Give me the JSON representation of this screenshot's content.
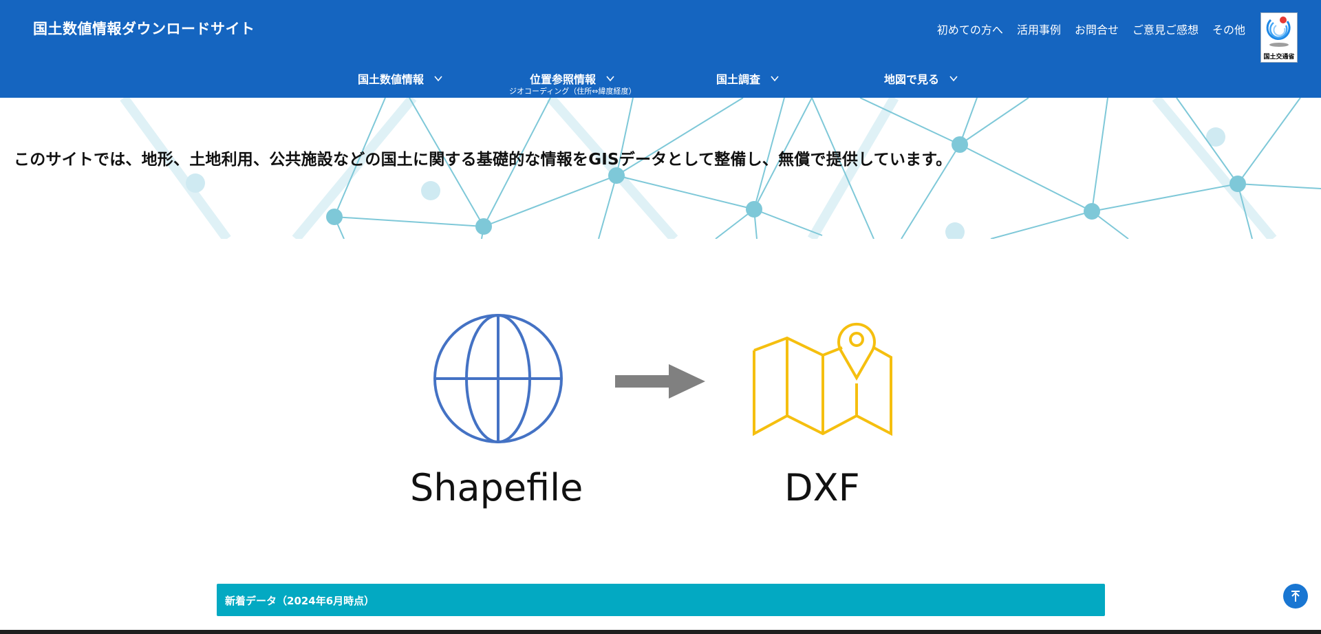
{
  "header": {
    "site_title": "国土数値情報ダウンロードサイト",
    "util_nav": [
      "初めての方へ",
      "活用事例",
      "お問合せ",
      "ご意見ご感想",
      "その他"
    ],
    "logo_text": "国土交通省"
  },
  "main_nav": {
    "items": [
      {
        "label": "国土数値情報"
      },
      {
        "label": "位置参照情報",
        "sub": "ジオコーディング（住所⇔緯度経度）"
      },
      {
        "label": "国土調査"
      },
      {
        "label": "地図で見る"
      }
    ]
  },
  "hero": {
    "text": "このサイトでは、地形、土地利用、公共施設などの国土に関する基礎的な情報をGISデータとして整備し、無償で提供しています。"
  },
  "conversion": {
    "from_label": "Shapefile",
    "to_label": "DXF",
    "from_icon": "globe-icon",
    "arrow_icon": "arrow-right-icon",
    "to_icon": "map-pin-icon",
    "colors": {
      "globe": "#4472c4",
      "arrow": "#808080",
      "map": "#f5bf0f"
    }
  },
  "news": {
    "title": "新着データ（2024年6月時点）"
  },
  "colors": {
    "header_bg": "#1565c0",
    "news_bg": "#03a9c2",
    "network": "#7ec8d8"
  }
}
